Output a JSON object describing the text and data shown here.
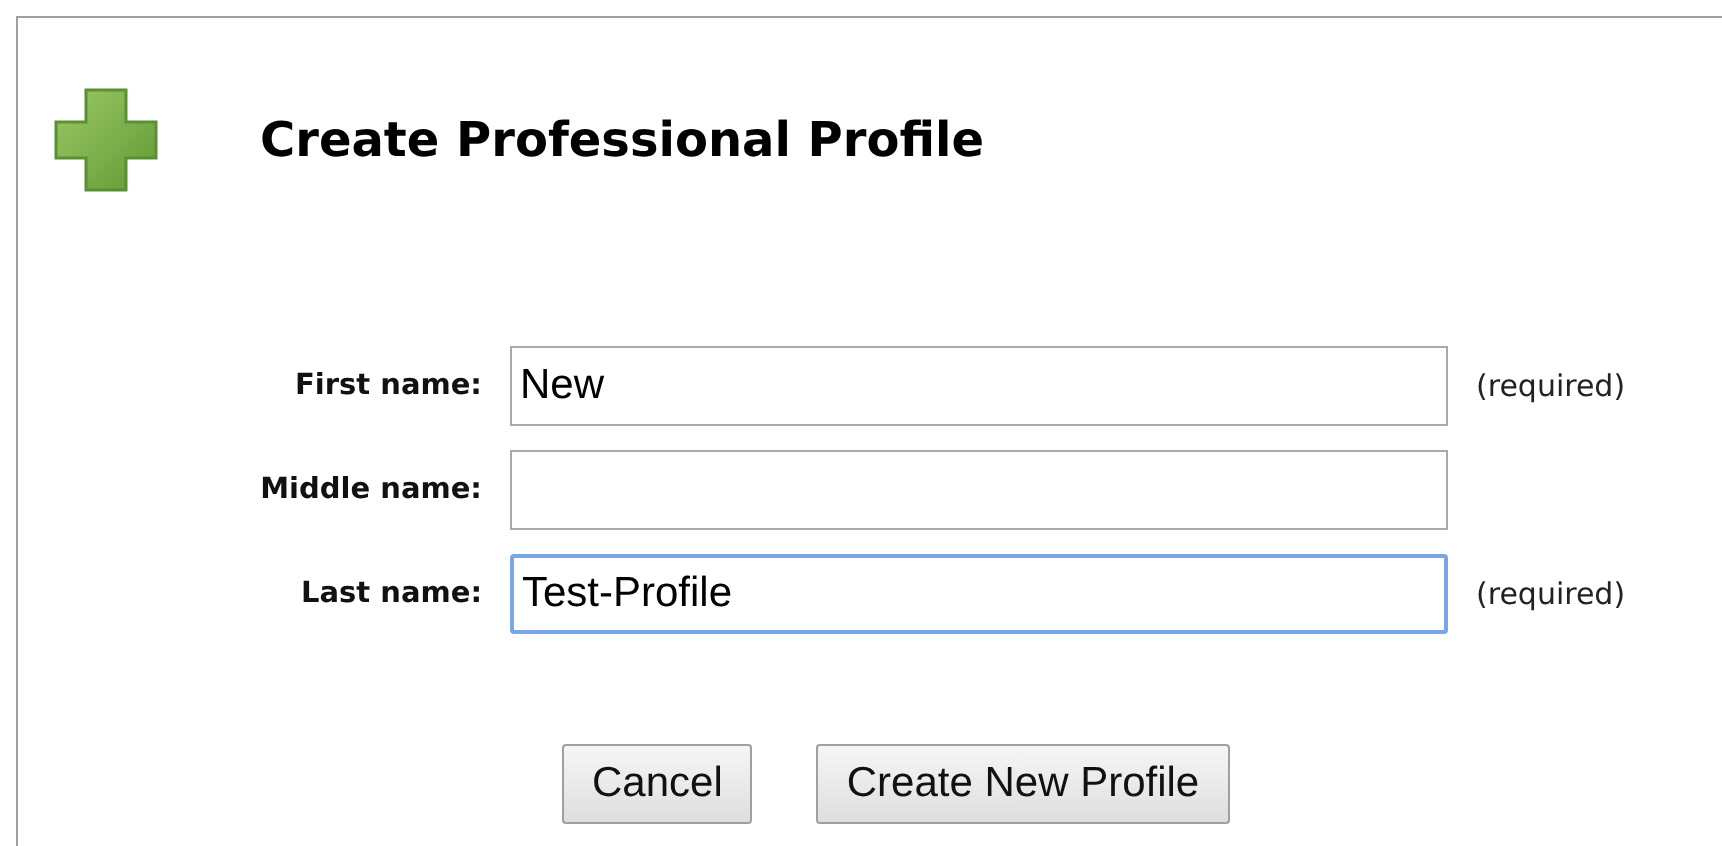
{
  "title": "Create Professional Profile",
  "fields": [
    {
      "label": "First name:",
      "value": "New",
      "note": "(required)",
      "focused": false
    },
    {
      "label": "Middle name:",
      "focused": false
    },
    {
      "label": "Last name:",
      "value": "Test-Profile",
      "note": "(required)",
      "focused": true
    }
  ],
  "buttons": [
    "Cancel",
    "Create New Profile"
  ]
}
